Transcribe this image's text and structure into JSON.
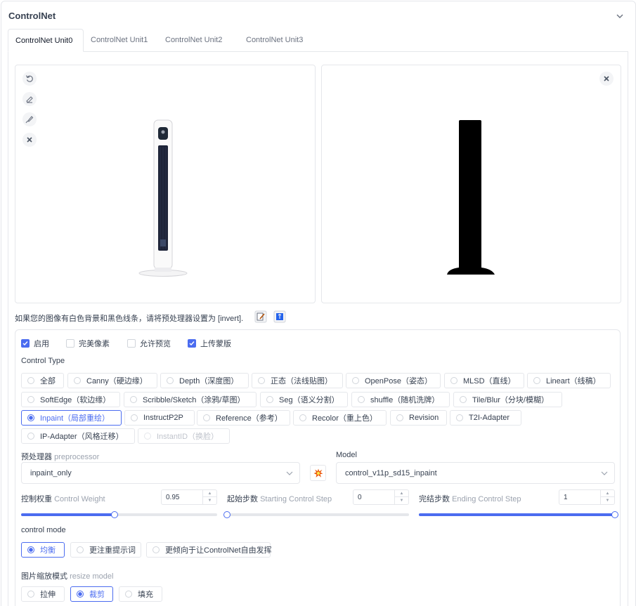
{
  "panel": {
    "title": "ControlNet"
  },
  "tabs": [
    "ControlNet Unit0",
    "ControlNet Unit1",
    "ControlNet Unit2",
    "ControlNet Unit3"
  ],
  "hint": {
    "text": "如果您的图像有白色背景和黑色线条，请将预处理器设置为 [invert]."
  },
  "options": {
    "enable": "启用",
    "pixel_perfect": "完美像素",
    "allow_preview": "允许预览",
    "upload_mask": "上传蒙版"
  },
  "control_type": {
    "label": "Control Type",
    "types": [
      "全部",
      "Canny（硬边缘）",
      "Depth（深度图）",
      "正态（法线贴图）",
      "OpenPose（姿态）",
      "MLSD（直线）",
      "Lineart（线稿）",
      "SoftEdge（软边缘）",
      "Scribble/Sketch（涂鸦/草图）",
      "Seg（语义分割）",
      "shuffle（随机洗牌）",
      "Tile/Blur（分块/模糊）",
      "Inpaint（局部重绘）",
      "InstructP2P",
      "Reference（参考）",
      "Recolor（重上色）",
      "Revision",
      "T2I-Adapter",
      "IP-Adapter（风格迁移）",
      "InstantID（换脸）"
    ],
    "selected": "Inpaint（局部重绘）"
  },
  "preprocessor": {
    "label": "预处理器",
    "sub": "preprocessor",
    "value": "inpaint_only"
  },
  "model": {
    "label": "Model",
    "value": "control_v11p_sd15_inpaint"
  },
  "weight": {
    "label": "控制权重",
    "sub": "Control Weight",
    "value": "0.95",
    "min": 0,
    "max": 2
  },
  "start_step": {
    "label": "起始步数",
    "sub": "Starting Control Step",
    "value": "0",
    "min": 0,
    "max": 1
  },
  "end_step": {
    "label": "完结步数",
    "sub": "Ending Control Step",
    "value": "1",
    "min": 0,
    "max": 1
  },
  "control_mode": {
    "label": "control mode",
    "options": [
      "均衡",
      "更注重提示词",
      "更倾向于让ControlNet自由发挥"
    ],
    "selected": "均衡"
  },
  "resize_mode": {
    "label": "图片缩放模式",
    "sub": "resize model",
    "options": [
      "拉伸",
      "裁剪",
      "填充"
    ],
    "selected": "裁剪"
  },
  "colors": {
    "accent": "#4b6cf0",
    "border": "#e5e7eb",
    "text": "#374151",
    "muted": "#9ca3af"
  }
}
